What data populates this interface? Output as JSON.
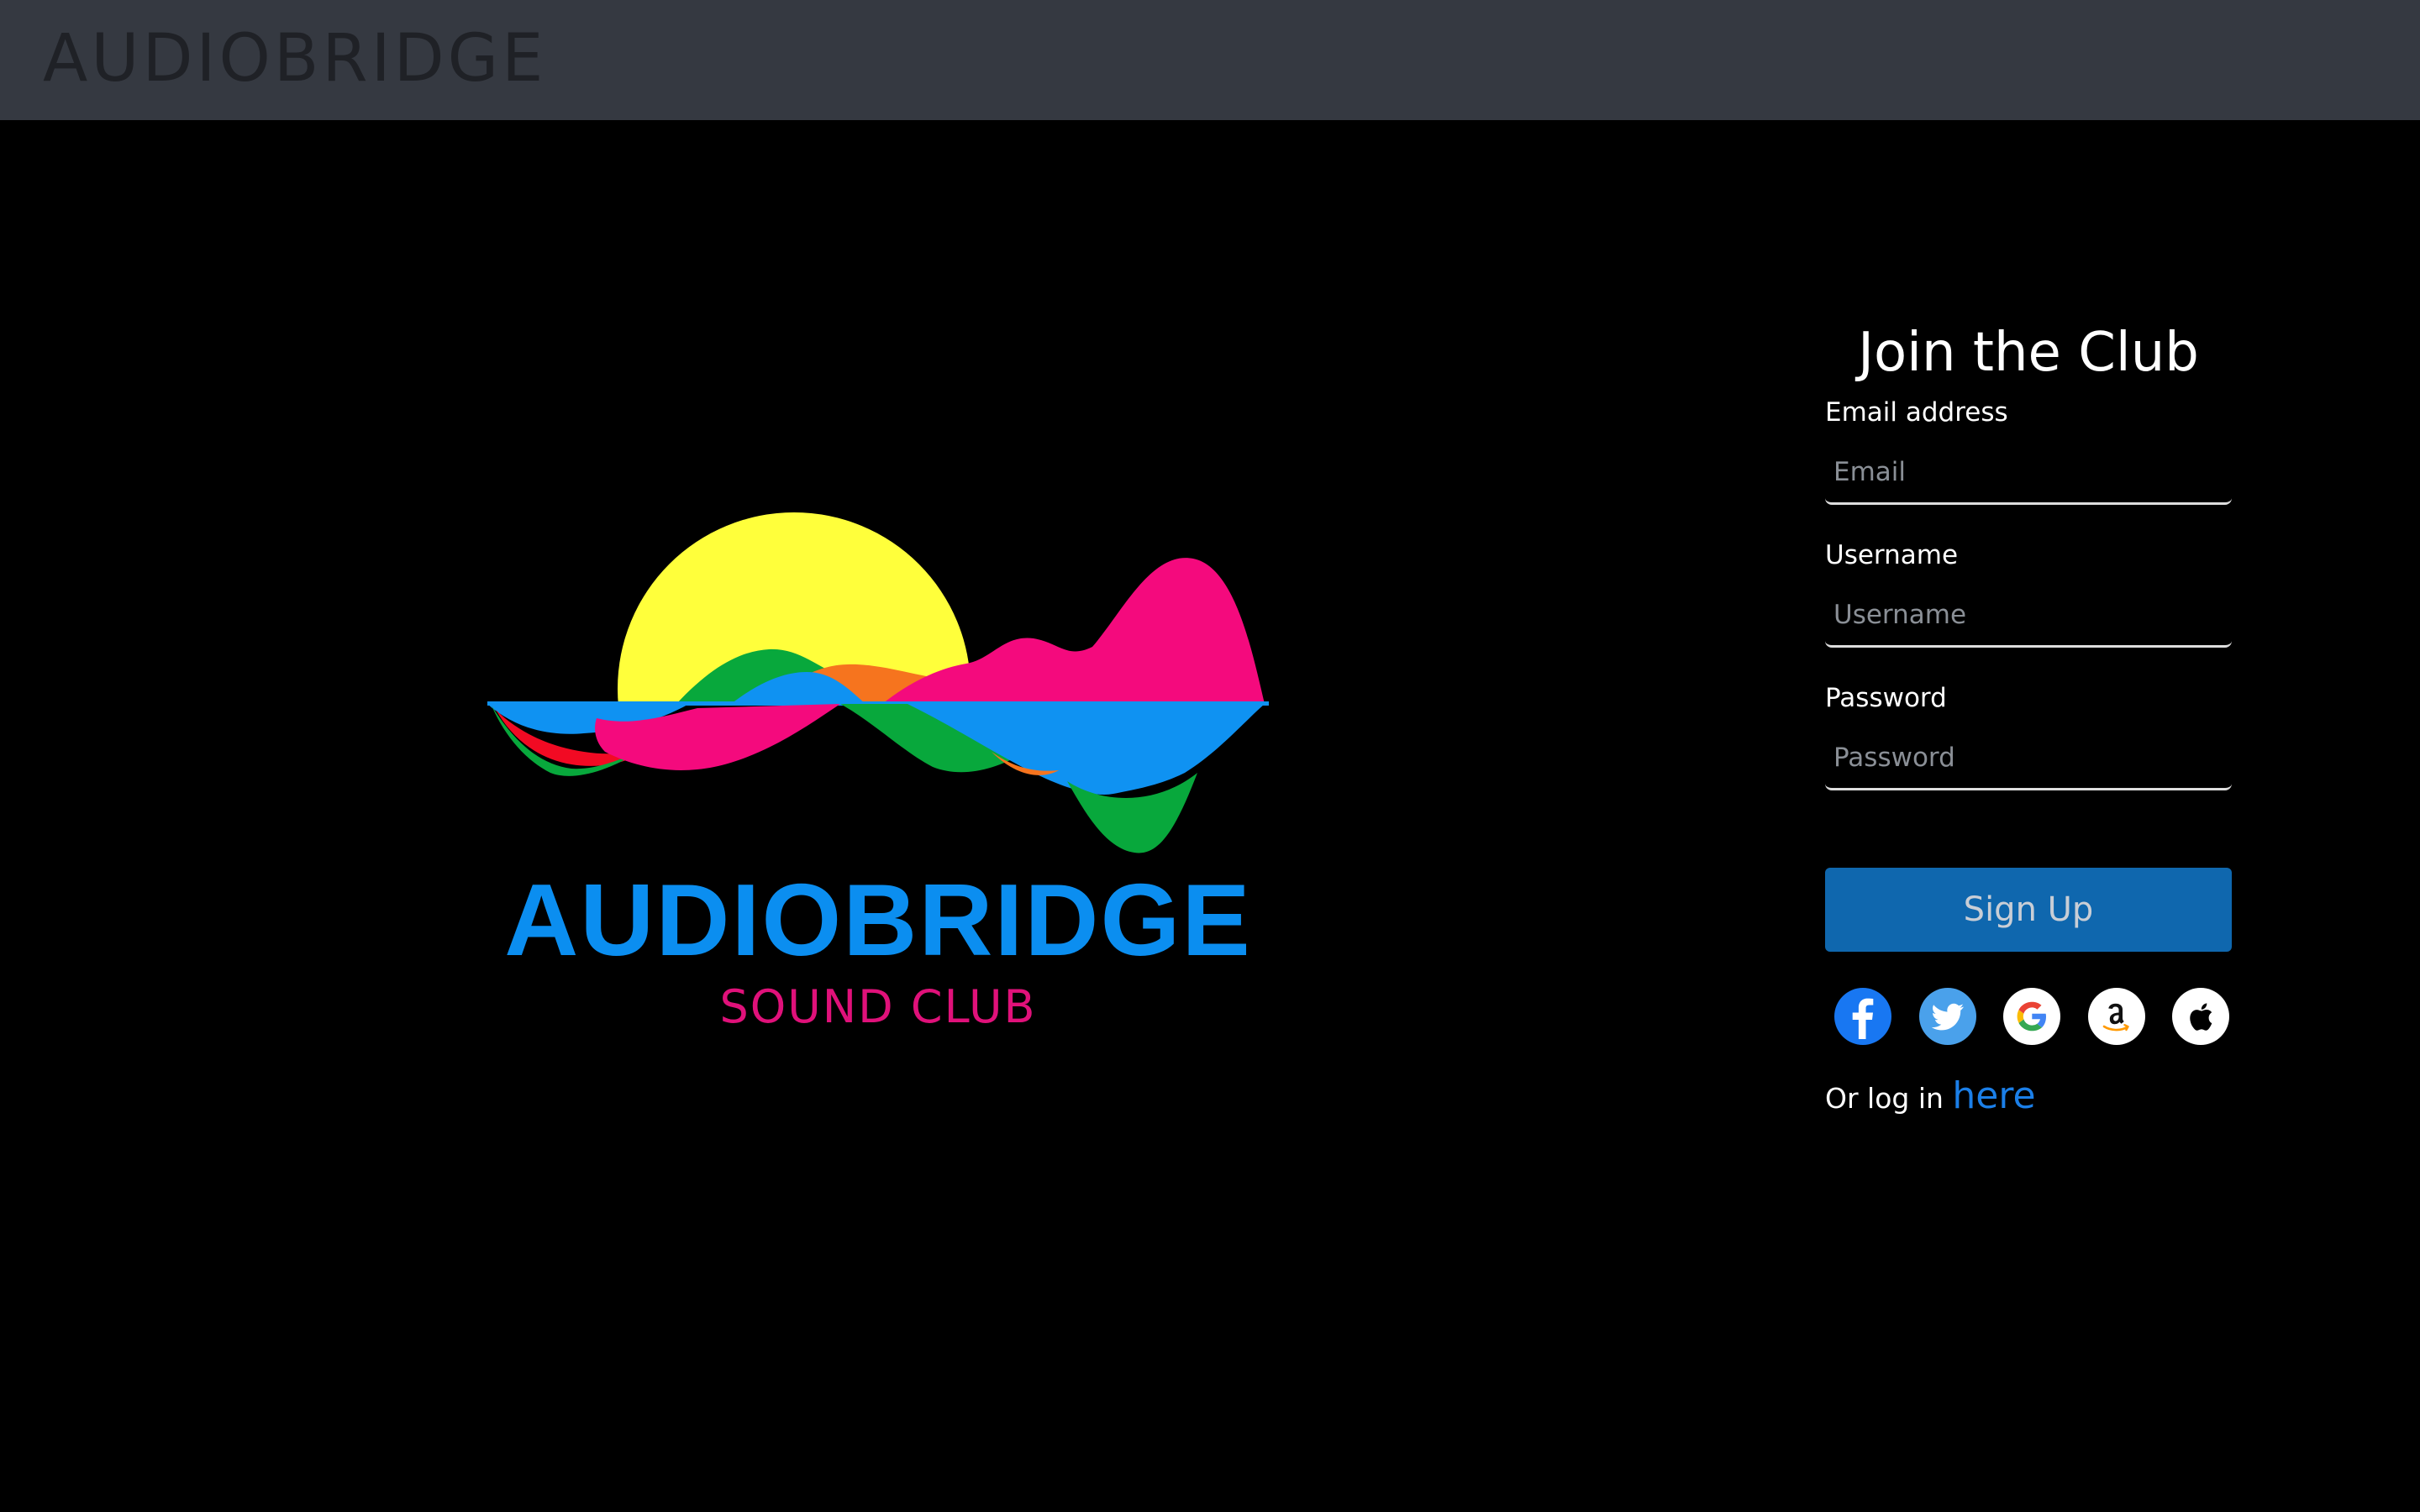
{
  "header": {
    "brand": "AUDIOBRIDGE"
  },
  "logo": {
    "title": "AUDIOBRIDGE",
    "subtitle": "SOUND CLUB",
    "colors": {
      "sun": "#ffff3b",
      "blue": "#0f92f2",
      "pink": "#f40a7d",
      "green": "#08a83c",
      "orange": "#f6741e",
      "red": "#f20a23"
    }
  },
  "signup_form": {
    "heading": "Join the Club",
    "email_label": "Email address",
    "email_placeholder": "Email",
    "username_label": "Username",
    "username_placeholder": "Username",
    "password_label": "Password",
    "password_placeholder": "Password",
    "submit_label": "Sign Up",
    "social_logins": [
      {
        "icon": "facebook-icon",
        "color": "#1877f2"
      },
      {
        "icon": "twitter-icon",
        "color": "#4aa1eb"
      },
      {
        "icon": "google-icon",
        "color": "#ffffff"
      },
      {
        "icon": "amazon-icon",
        "color": "#ffffff"
      },
      {
        "icon": "apple-icon",
        "color": "#ffffff"
      }
    ],
    "login_prompt": "Or log in",
    "login_link": "here"
  },
  "colors": {
    "topbar": "#353941",
    "background": "#000000",
    "accent": "#0f67ae",
    "link": "#1b7fe8"
  }
}
